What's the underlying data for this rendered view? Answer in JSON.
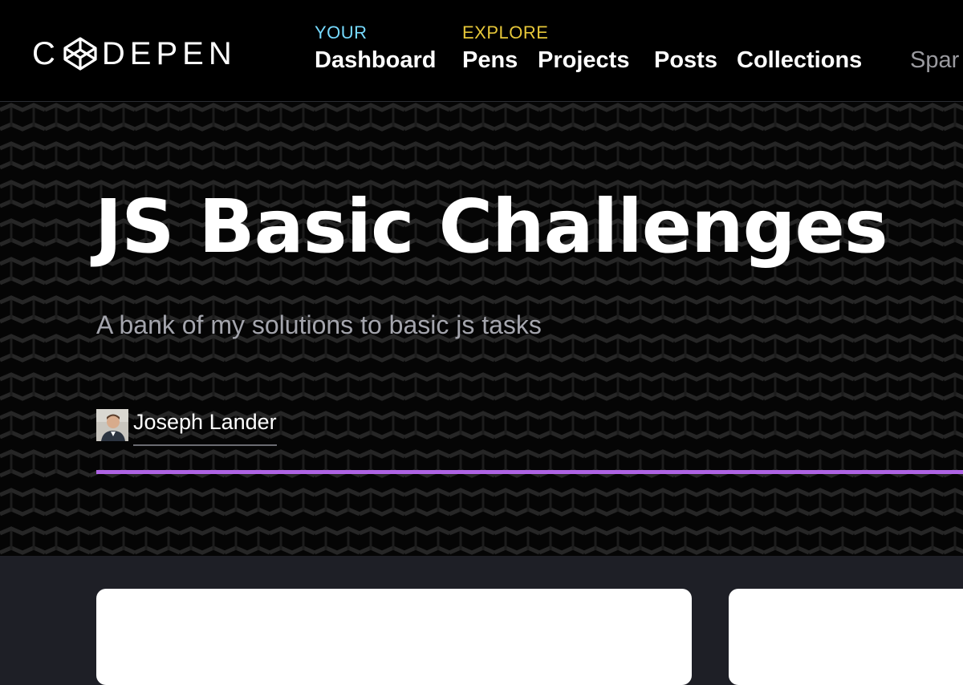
{
  "brand": {
    "logo_left": "C",
    "logo_right": "DEPEN"
  },
  "nav": {
    "your_label": "YOUR",
    "explore_label": "EXPLORE",
    "links": {
      "dashboard": "Dashboard",
      "pens": "Pens",
      "projects": "Projects",
      "posts": "Posts",
      "collections": "Collections",
      "spark": "Spar"
    }
  },
  "collection": {
    "title": "JS Basic Challenges",
    "description": "A bank of my solutions to basic js tasks",
    "author": "Joseph Lander"
  },
  "colors": {
    "your_label": "#76daff",
    "explore_label": "#ffdd40",
    "accent_bar": "#ae63e4"
  }
}
